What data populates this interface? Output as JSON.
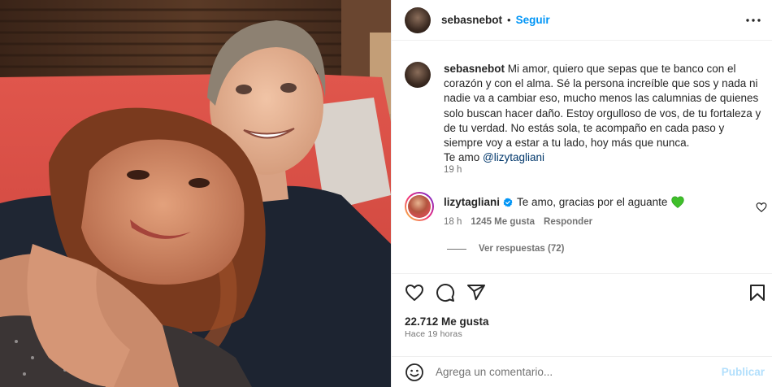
{
  "post": {
    "author": "sebasnebot",
    "dot": "•",
    "follow_label": "Seguir",
    "caption": {
      "username": "sebasnebot",
      "text": "Mi amor, quiero que sepas que te banco con el corazón y con el alma. Sé la persona increíble que sos y nada ni nadie va a cambiar eso, mucho menos las calumnias de quienes solo buscan hacer daño. Estoy orgulloso de vos, de tu fortaleza y de tu verdad. No estás sola, te acompaño en cada paso y siempre voy a estar a tu lado, hoy más que nunca.",
      "closing": "Te amo",
      "mention": "@lizytagliani",
      "time": "19 h"
    },
    "comment": {
      "username": "lizytagliani",
      "text": "Te amo, gracias por el aguante",
      "time": "18 h",
      "likes": "1245 Me gusta",
      "reply_label": "Responder",
      "view_replies": "Ver respuestas (72)"
    },
    "likes": "22.712 Me gusta",
    "posted": "Hace 19 horas",
    "add_comment": {
      "placeholder": "Agrega un comentario...",
      "publish_label": "Publicar"
    }
  },
  "icons": {
    "more": "more-horizontal-icon",
    "like": "heart-icon",
    "comment": "comment-bubble-icon",
    "share": "paper-plane-icon",
    "save": "bookmark-icon",
    "emoji": "emoji-smile-icon",
    "verified": "verified-badge-icon",
    "green_heart": "green-heart-emoji"
  },
  "colors": {
    "accent": "#0095f6",
    "mention": "#00376b",
    "secondary_text": "#737373",
    "verified": "#0095f6",
    "publish_disabled": "#b2dffc"
  }
}
